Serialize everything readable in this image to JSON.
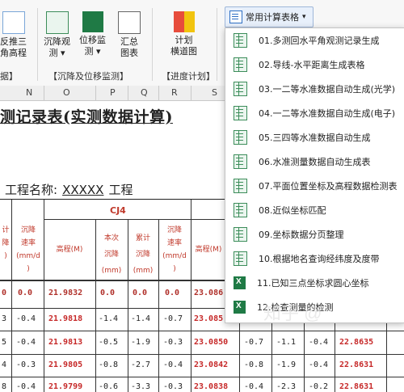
{
  "ribbon": {
    "buttons": [
      {
        "label": "反推三\n角高程"
      },
      {
        "label": "沉降观\n测 ▾"
      },
      {
        "label": "位移监\n测 ▾"
      },
      {
        "label": "汇总\n图表"
      },
      {
        "label": "计划\n横道图"
      }
    ],
    "groups": {
      "left": "据】",
      "settlement": "【沉降及位移监测】",
      "plan": "【进度计划】"
    },
    "dropdown_label": "常用计算表格"
  },
  "columns": [
    "N",
    "O",
    "P",
    "Q",
    "R",
    "S"
  ],
  "sheet": {
    "title": "测记录表(实测数据计算)",
    "project_label": "工程名称:",
    "project_value": "XXXXX",
    "project_suffix": "工程",
    "point": "CJ4",
    "headers": {
      "c0": "计\n降\n)",
      "c1": "沉降\n速率\n(mm/d\n)",
      "c2": "高程(M)",
      "c3": "本次\n沉降\n(mm)",
      "c4": "累计\n沉降\n(mm)",
      "c5": "沉降\n速率\n(mm/d\n)",
      "c6": "高程(M)"
    },
    "rows": [
      {
        "a": "0",
        "b": "0.0",
        "c": "21.9832",
        "d": "0.0",
        "e": "0.0",
        "f": "0.0",
        "g": "23.086",
        "h": "",
        "i": "",
        "j": "",
        "k": ""
      },
      {
        "a": "3",
        "b": "-0.4",
        "c": "21.9818",
        "d": "-1.4",
        "e": "-1.4",
        "f": "-0.7",
        "g": "23.085",
        "h": "",
        "i": "",
        "j": "",
        "k": ""
      },
      {
        "a": "5",
        "b": "-0.4",
        "c": "21.9813",
        "d": "-0.5",
        "e": "-1.9",
        "f": "-0.3",
        "g": "23.0850",
        "h": "-0.7",
        "i": "-1.1",
        "j": "-0.4",
        "k": "22.8635"
      },
      {
        "a": "4",
        "b": "-0.3",
        "c": "21.9805",
        "d": "-0.8",
        "e": "-2.7",
        "f": "-0.4",
        "g": "23.0842",
        "h": "-0.8",
        "i": "-1.9",
        "j": "-0.4",
        "k": "22.8631"
      },
      {
        "a": "8",
        "b": "-0.4",
        "c": "21.9799",
        "d": "-0.6",
        "e": "-3.3",
        "f": "-0.3",
        "g": "23.0838",
        "h": "-0.4",
        "i": "-2.3",
        "j": "-0.2",
        "k": "22.8631"
      }
    ]
  },
  "menu": {
    "items": [
      {
        "label": "01.多测回水平角观测记录生成",
        "icon": "table-icon"
      },
      {
        "label": "02.导线-水平距离生成表格",
        "icon": "table-icon"
      },
      {
        "label": "03.一二等水准数据自动生成(光学)",
        "icon": "table-icon"
      },
      {
        "label": "04.一二等水准数据自动生成(电子)",
        "icon": "table-icon"
      },
      {
        "label": "05.三四等水准数据自动生成",
        "icon": "table-icon"
      },
      {
        "label": "06.水准测量数据自动生成表",
        "icon": "table-icon"
      },
      {
        "label": "07.平面位置坐标及高程数据检测表",
        "icon": "table-icon"
      },
      {
        "label": "08.近似坐标匹配",
        "icon": "table-icon"
      },
      {
        "label": "09.坐标数据分页整理",
        "icon": "table-icon"
      },
      {
        "label": "10.根据地名查询经纬度及度带",
        "icon": "table-icon"
      },
      {
        "label": "11.已知三点坐标求圆心坐标",
        "icon": "excel-icon"
      },
      {
        "label": "12.检查测量的检测",
        "icon": "excel-icon"
      }
    ]
  },
  "watermark": "知乎 @"
}
